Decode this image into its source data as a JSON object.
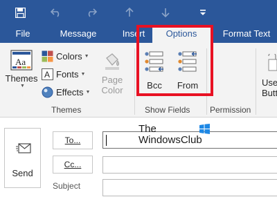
{
  "quick_access": {
    "icons": [
      "save-icon",
      "undo-icon",
      "redo-icon",
      "up-arrow-icon",
      "down-arrow-icon",
      "customize-toolbar-icon"
    ]
  },
  "tabs": [
    {
      "label": "File",
      "active": false
    },
    {
      "label": "Message",
      "active": false
    },
    {
      "label": "Insert",
      "active": false
    },
    {
      "label": "Options",
      "active": true
    },
    {
      "label": "Format Text",
      "active": false
    }
  ],
  "ribbon": {
    "themes_group": {
      "label": "Themes",
      "themes_button": "Themes",
      "colors": "Colors",
      "fonts": "Fonts",
      "effects": "Effects",
      "page_color": "Page Color"
    },
    "show_fields_group": {
      "label": "Show Fields",
      "bcc": "Bcc",
      "from": "From"
    },
    "permission_group": {
      "label": "Permission",
      "use_button": "Use",
      "use_button_line2": "Butt"
    }
  },
  "compose": {
    "send": "Send",
    "to": "To...",
    "cc": "Cc...",
    "subject": "Subject",
    "to_value": "",
    "cc_value": "",
    "subject_value": ""
  },
  "watermark": {
    "line1": "The",
    "line2": "WindowsClub"
  },
  "colors": {
    "accent": "#2b579a",
    "ribbon_bg": "#f3f3f3",
    "highlight": "#e81123"
  }
}
